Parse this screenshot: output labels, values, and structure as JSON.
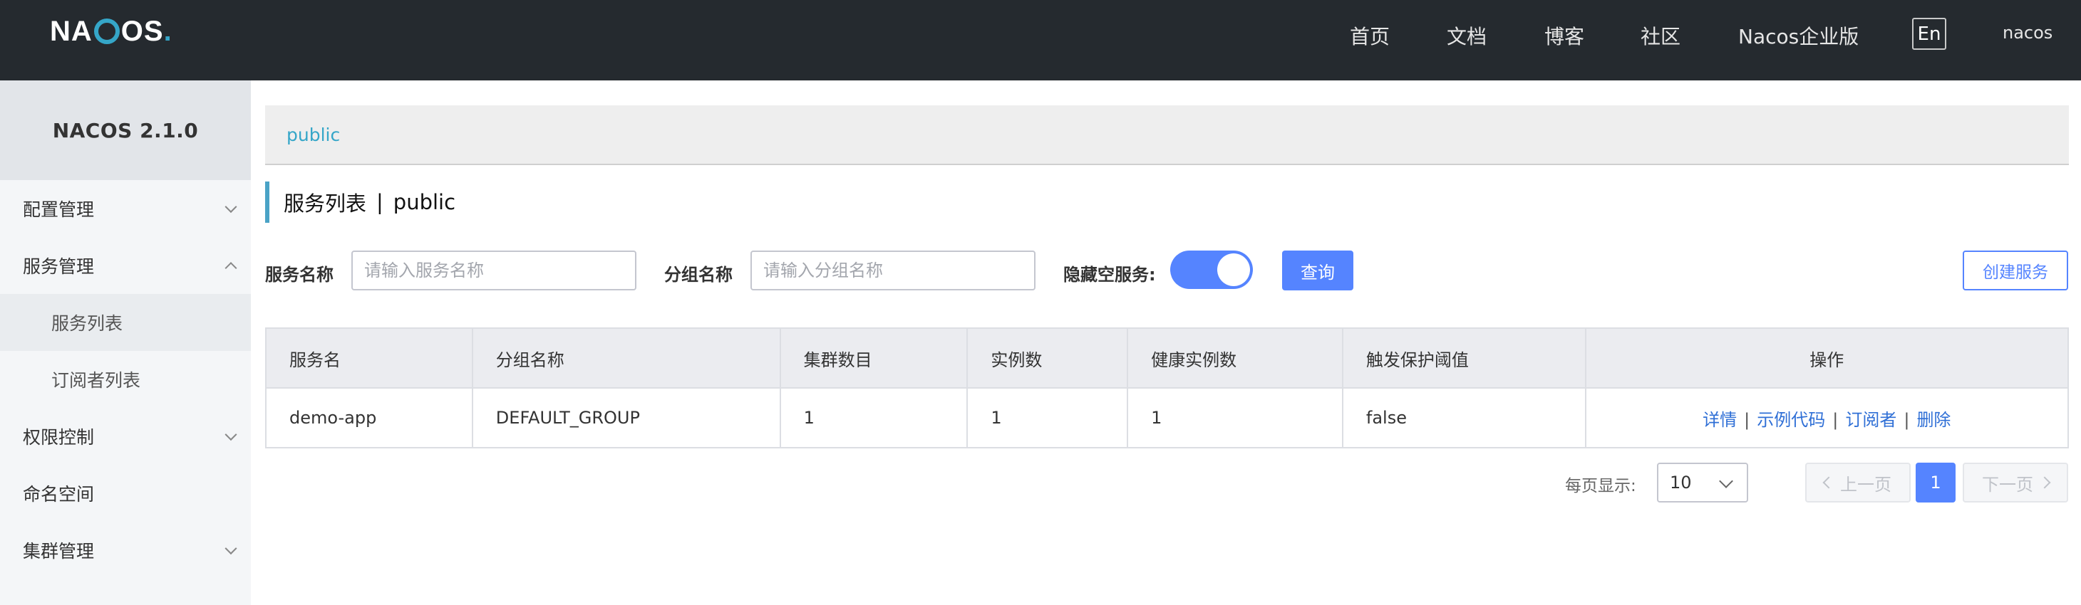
{
  "header": {
    "logo_text": "NACOS.",
    "nav": [
      "首页",
      "文档",
      "博客",
      "社区",
      "Nacos企业版"
    ],
    "lang": "En",
    "user": "nacos"
  },
  "sidebar": {
    "title": "NACOS 2.1.0",
    "items": [
      {
        "label": "配置管理",
        "expanded": false
      },
      {
        "label": "服务管理",
        "expanded": true
      },
      {
        "label": "服务列表",
        "sub": true,
        "active": true
      },
      {
        "label": "订阅者列表",
        "sub": true
      },
      {
        "label": "权限控制",
        "expanded": false
      },
      {
        "label": "命名空间"
      },
      {
        "label": "集群管理",
        "expanded": false
      }
    ]
  },
  "breadcrumb": {
    "namespace": "public"
  },
  "page": {
    "title": "服务列表",
    "separator": "|",
    "namespace": "public"
  },
  "filters": {
    "service_name_label": "服务名称",
    "service_name_placeholder": "请输入服务名称",
    "service_name_value": "",
    "group_name_label": "分组名称",
    "group_name_placeholder": "请输入分组名称",
    "group_name_value": "",
    "hide_empty_label": "隐藏空服务:",
    "hide_empty_on": true,
    "query_button": "查询",
    "create_button": "创建服务"
  },
  "table": {
    "columns": [
      "服务名",
      "分组名称",
      "集群数目",
      "实例数",
      "健康实例数",
      "触发保护阈值",
      "操作"
    ],
    "rows": [
      {
        "cells": [
          "demo-app",
          "DEFAULT_GROUP",
          "1",
          "1",
          "1",
          "false"
        ],
        "actions": [
          "详情",
          "示例代码",
          "订阅者",
          "删除"
        ]
      }
    ],
    "action_separator": "|"
  },
  "pagination": {
    "page_size_label": "每页显示:",
    "page_size": "10",
    "prev_label": "上一页",
    "next_label": "下一页",
    "current_page": "1"
  },
  "colors": {
    "header_bg": "#252a2f",
    "primary": "#5584ff",
    "link": "#2f6fd6",
    "accent": "#35a6c8"
  }
}
